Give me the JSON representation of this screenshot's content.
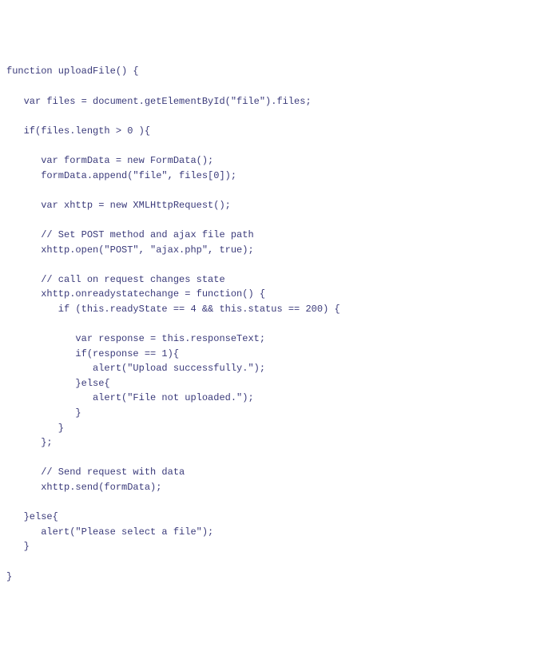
{
  "code": {
    "lines": [
      "function uploadFile() {",
      "",
      "   var files = document.getElementById(\"file\").files;",
      "",
      "   if(files.length > 0 ){",
      "",
      "      var formData = new FormData();",
      "      formData.append(\"file\", files[0]);",
      "",
      "      var xhttp = new XMLHttpRequest();",
      "",
      "      // Set POST method and ajax file path",
      "      xhttp.open(\"POST\", \"ajax.php\", true);",
      "",
      "      // call on request changes state",
      "      xhttp.onreadystatechange = function() {",
      "         if (this.readyState == 4 && this.status == 200) {",
      "",
      "            var response = this.responseText;",
      "            if(response == 1){",
      "               alert(\"Upload successfully.\");",
      "            }else{",
      "               alert(\"File not uploaded.\");",
      "            }",
      "         }",
      "      };",
      "",
      "      // Send request with data",
      "      xhttp.send(formData);",
      "",
      "   }else{",
      "      alert(\"Please select a file\");",
      "   }",
      "",
      "}"
    ]
  }
}
